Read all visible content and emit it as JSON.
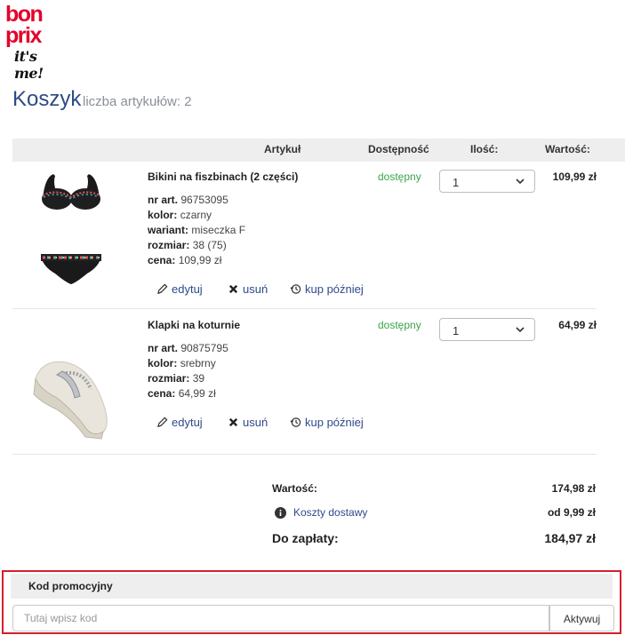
{
  "brand": {
    "line1": "bon",
    "line2": "prix",
    "tagline": "it's me!"
  },
  "cart": {
    "title": "Koszyk",
    "count_label": "liczba artykułów: 2"
  },
  "table_header": {
    "article": "Artykuł",
    "availability": "Dostępność",
    "quantity": "Ilość:",
    "value": "Wartość:"
  },
  "items": [
    {
      "name": "Bikini na fiszbinach (2 części)",
      "attrs": [
        {
          "label": "nr art.",
          "value": "96753095"
        },
        {
          "label": "kolor:",
          "value": "czarny"
        },
        {
          "label": "wariant:",
          "value": "miseczka F"
        },
        {
          "label": "rozmiar:",
          "value": "38 (75)"
        },
        {
          "label": "cena:",
          "value": "109,99 zł"
        }
      ],
      "status": "dostępny",
      "quantity": "1",
      "price": "109,99 zł",
      "actions": {
        "edit": "edytuj",
        "remove": "usuń",
        "later": "kup później"
      }
    },
    {
      "name": "Klapki na koturnie",
      "attrs": [
        {
          "label": "nr art.",
          "value": "90875795"
        },
        {
          "label": "kolor:",
          "value": "srebrny"
        },
        {
          "label": "rozmiar:",
          "value": "39"
        },
        {
          "label": "cena:",
          "value": "64,99 zł"
        }
      ],
      "status": "dostępny",
      "quantity": "1",
      "price": "64,99 zł",
      "actions": {
        "edit": "edytuj",
        "remove": "usuń",
        "later": "kup później"
      }
    }
  ],
  "summary": {
    "value_label": "Wartość:",
    "value": "174,98 zł",
    "shipping_label": "Koszty dostawy",
    "shipping": "od 9,99 zł",
    "total_label": "Do zapłaty:",
    "total": "184,97 zł"
  },
  "promo": {
    "title": "Kod promocyjny",
    "placeholder": "Tutaj wpisz kod",
    "button": "Aktywuj"
  },
  "colors": {
    "brand_red": "#e4002b",
    "link_blue": "#2f4a8a",
    "available_green": "#3aa44a",
    "highlight_border": "#d61f2c"
  }
}
